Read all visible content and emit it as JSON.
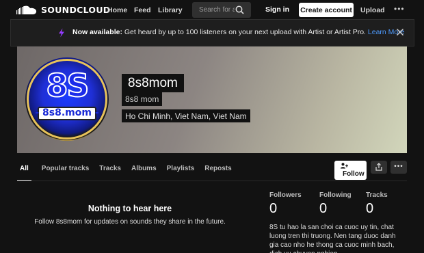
{
  "nav": {
    "logo_text": "SOUNDCLOUD",
    "home": "Home",
    "feed": "Feed",
    "library": "Library",
    "search_placeholder": "Search for a",
    "sign_in": "Sign in",
    "create_account": "Create account",
    "upload": "Upload",
    "more": "•••"
  },
  "promo": {
    "headline": "Now available:",
    "text": " Get heard by up to 100 listeners on your next upload with Artist or Artist Pro. ",
    "link": "Learn More"
  },
  "profile": {
    "display_name": "8s8mom",
    "username": "8s8 mom",
    "location": "Ho Chi Minh, Viet Nam, Viet Nam",
    "avatar_big_text": "8S",
    "avatar_site_text": "- 8s8.mom -"
  },
  "tabs": [
    {
      "label": "All",
      "active": true
    },
    {
      "label": "Popular tracks",
      "active": false
    },
    {
      "label": "Tracks",
      "active": false
    },
    {
      "label": "Albums",
      "active": false
    },
    {
      "label": "Playlists",
      "active": false
    },
    {
      "label": "Reposts",
      "active": false
    }
  ],
  "actions": {
    "follow": "Follow",
    "more": "•••"
  },
  "empty_state": {
    "title": "Nothing to hear here",
    "subtitle": "Follow 8s8mom for updates on sounds they share in the future."
  },
  "stats": {
    "followers_label": "Followers",
    "followers_value": "0",
    "following_label": "Following",
    "following_value": "0",
    "tracks_label": "Tracks",
    "tracks_value": "0"
  },
  "bio": "8S tu hao la san choi ca cuoc uy tin, chat luong tren thi truong. Nen tang duoc danh gia cao nho he thong ca cuoc minh bach, dich vu chuyen nghiep"
}
